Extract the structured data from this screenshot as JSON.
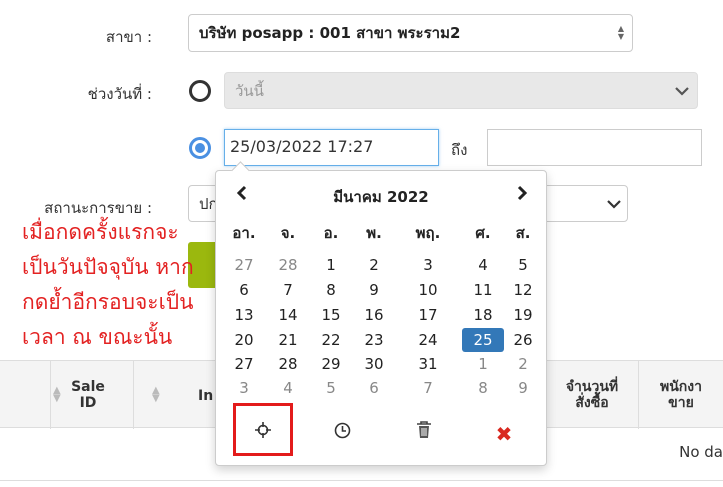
{
  "form": {
    "branch_label": "สาขา :",
    "branch_value": "บริษัท posapp : 001 สาขา พระราม2",
    "date_range_label": "ช่วงวันที่ :",
    "preset_value": "วันนี้",
    "date_from": "25/03/2022 17:27",
    "to_label": "ถึง",
    "date_to": "",
    "sale_status_label": "สถานะการขาย :",
    "sale_status_value": "ปก"
  },
  "annotation": {
    "lines": [
      "เมื่อกดครั้งแรกจะ",
      "เป็นวันปัจจุบัน หาก",
      "กดย้ำอีกรอบจะเป็น",
      "เวลา ณ ขณะนั้น"
    ],
    "color": "#e32222"
  },
  "table": {
    "headers": [
      "Sale ID",
      "In",
      "จำนวนที่ สั่งซื้อ",
      "พนักงา ขาย"
    ],
    "empty_text": "No da"
  },
  "datepicker": {
    "month_title": "มีนาคม 2022",
    "weekdays": [
      "อา.",
      "จ.",
      "อ.",
      "พ.",
      "พฤ.",
      "ศ.",
      "ส."
    ],
    "weeks": [
      [
        "27",
        "28",
        "1",
        "2",
        "3",
        "4",
        "5"
      ],
      [
        "6",
        "7",
        "8",
        "9",
        "10",
        "11",
        "12"
      ],
      [
        "13",
        "14",
        "15",
        "16",
        "17",
        "18",
        "19"
      ],
      [
        "20",
        "21",
        "22",
        "23",
        "24",
        "25",
        "26"
      ],
      [
        "27",
        "28",
        "29",
        "30",
        "31",
        "1",
        "2"
      ],
      [
        "3",
        "4",
        "5",
        "6",
        "7",
        "8",
        "9"
      ]
    ],
    "muted": [
      [
        0,
        0
      ],
      [
        0,
        1
      ],
      [
        4,
        5
      ],
      [
        4,
        6
      ],
      [
        5,
        0
      ],
      [
        5,
        1
      ],
      [
        5,
        2
      ],
      [
        5,
        3
      ],
      [
        5,
        4
      ],
      [
        5,
        5
      ],
      [
        5,
        6
      ]
    ],
    "selected": [
      3,
      5
    ],
    "selected_color": "#3378b8",
    "tools": [
      "crosshairs-icon",
      "clock-icon",
      "trash-icon",
      "close-icon"
    ]
  }
}
